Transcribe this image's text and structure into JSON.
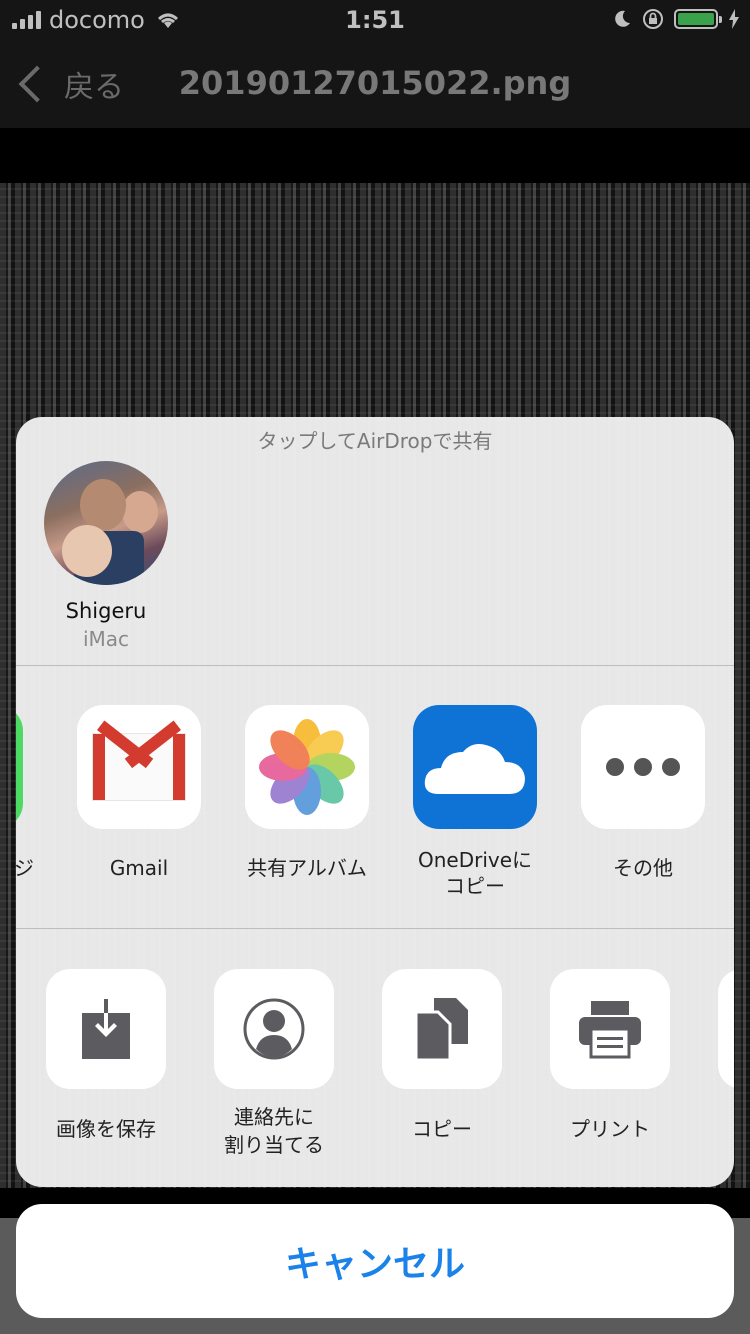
{
  "status_bar": {
    "carrier": "docomo",
    "time": "1:51",
    "battery_level": 1.0
  },
  "nav": {
    "back_label": "戻る",
    "title": "20190127015022.png"
  },
  "share_sheet": {
    "airdrop_caption": "タップしてAirDropで共有",
    "airdrop_contact": {
      "name": "Shigeru",
      "device": "iMac"
    },
    "apps": [
      {
        "label": "ジ",
        "icon": "messages-icon"
      },
      {
        "label": "Gmail",
        "icon": "gmail-icon"
      },
      {
        "label": "共有アルバム",
        "icon": "photos-icon"
      },
      {
        "label_line1": "OneDriveに",
        "label_line2": "コピー",
        "icon": "onedrive-icon"
      },
      {
        "label": "その他",
        "icon": "more-icon"
      }
    ],
    "actions": [
      {
        "label": "画像を保存",
        "icon": "save-image-icon"
      },
      {
        "label_line1": "連絡先に",
        "label_line2": "割り当てる",
        "icon": "assign-contact-icon"
      },
      {
        "label": "コピー",
        "icon": "copy-icon"
      },
      {
        "label": "プリント",
        "icon": "print-icon"
      }
    ]
  },
  "cancel_label": "キャンセル",
  "colors": {
    "accent": "#1a82e8",
    "battery": "#4cd964",
    "gmail_red": "#d33b2f",
    "onedrive_blue": "#0f73d6"
  }
}
